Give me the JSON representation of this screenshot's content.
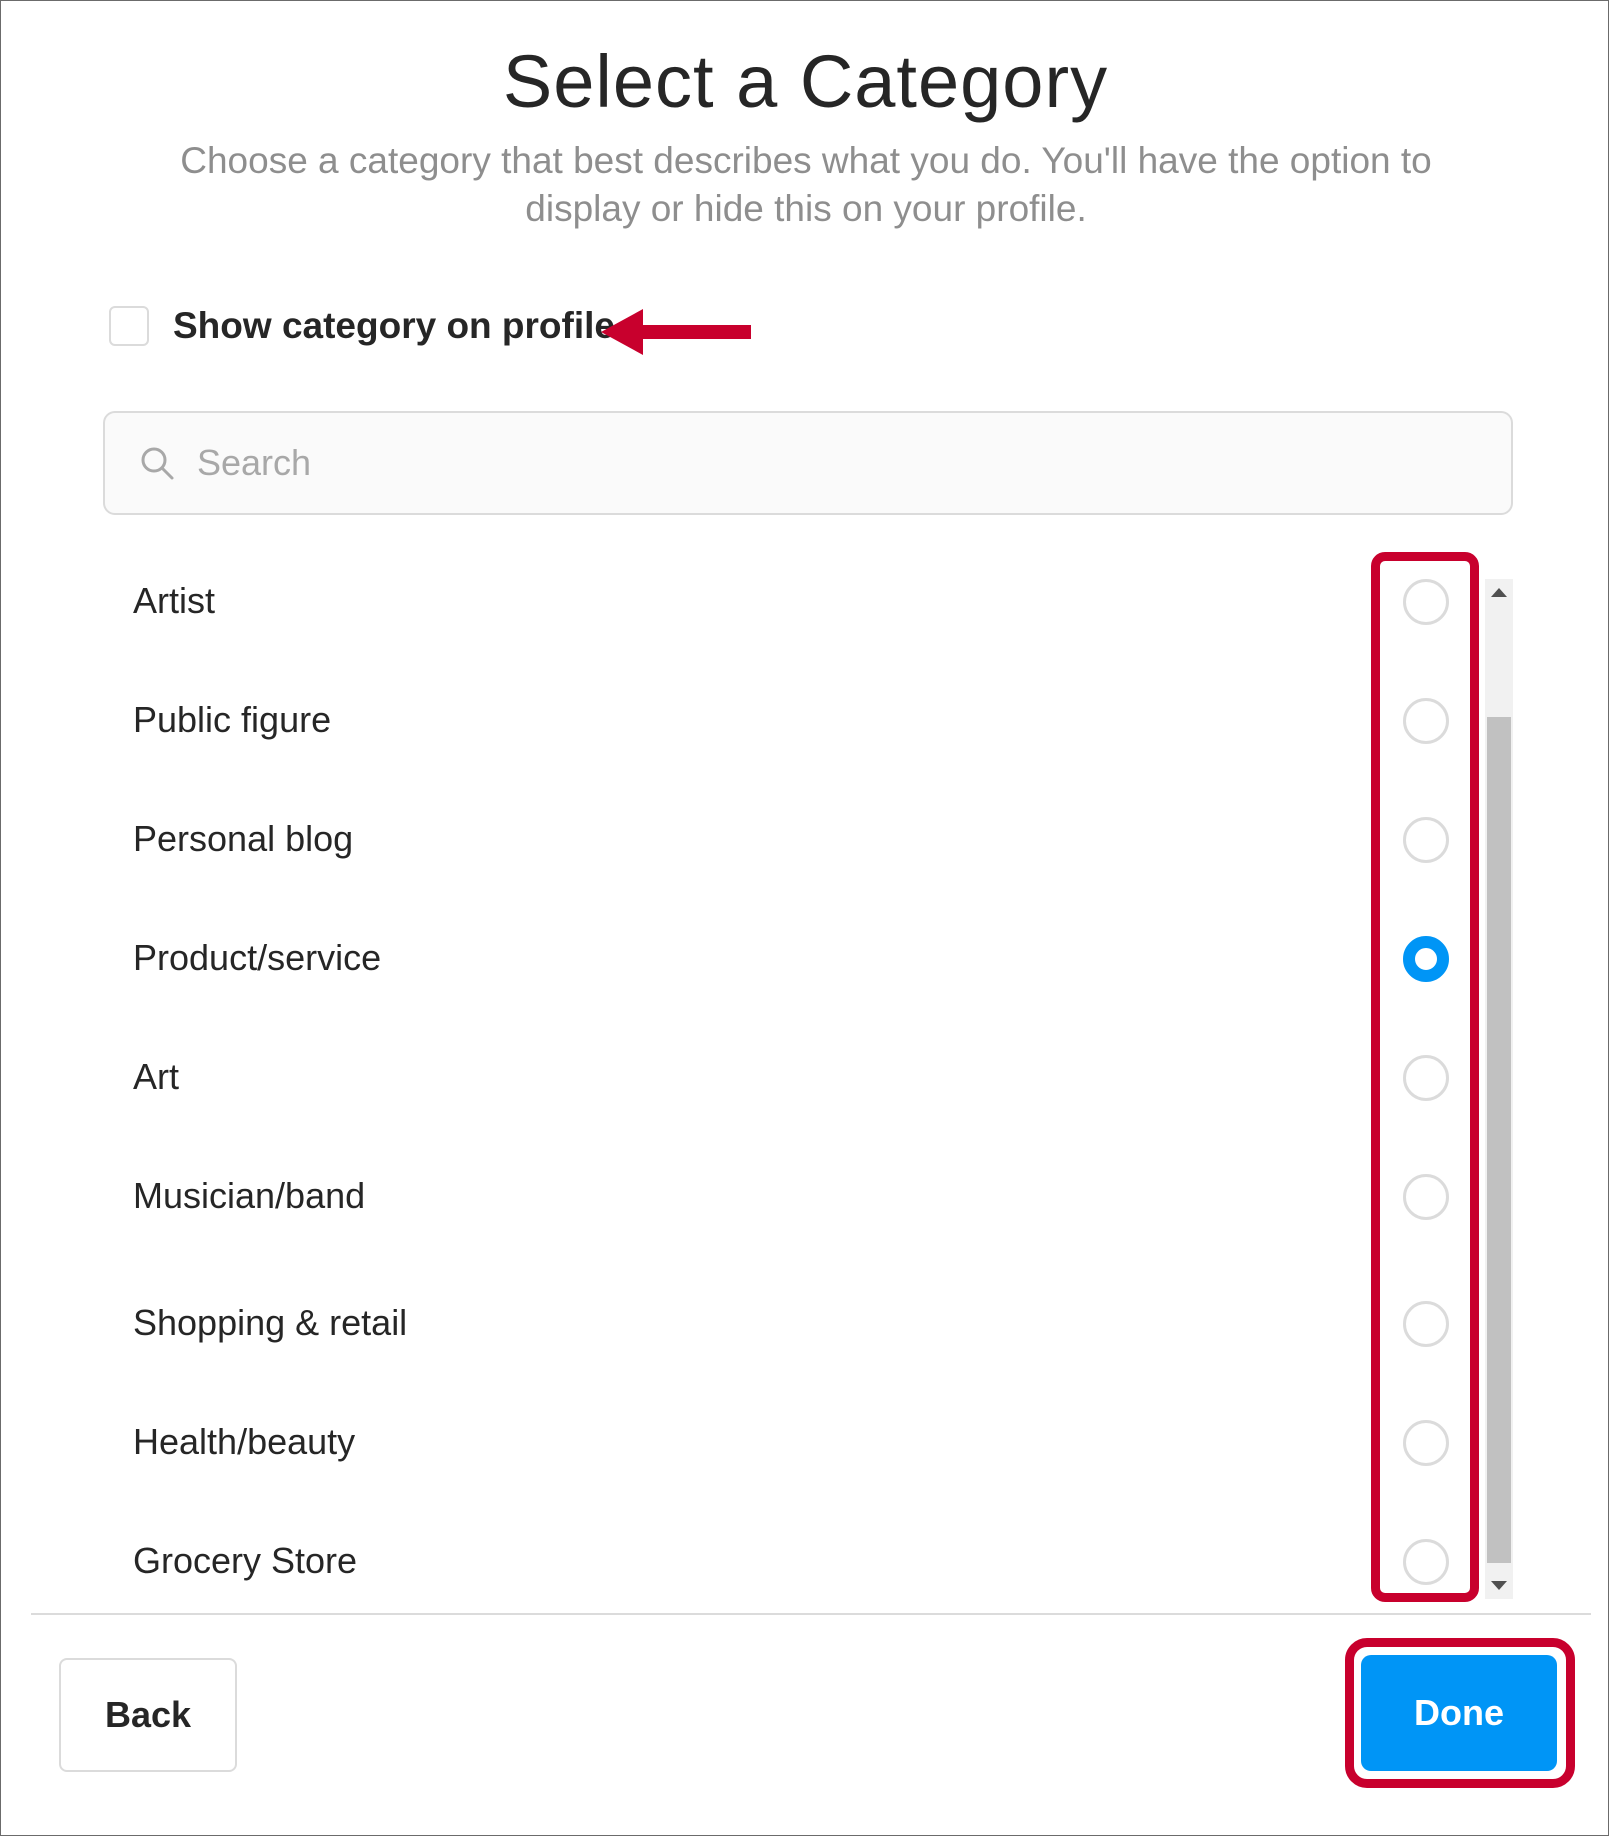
{
  "dialog": {
    "title": "Select a Category",
    "subtitle": "Choose a category that best describes what you do. You'll have the option to display or hide this on your profile."
  },
  "show_category": {
    "label": "Show category on profile",
    "checked": false
  },
  "search": {
    "placeholder": "Search",
    "value": ""
  },
  "categories": [
    {
      "label": "Artist",
      "selected": false
    },
    {
      "label": "Public figure",
      "selected": false
    },
    {
      "label": "Personal blog",
      "selected": false
    },
    {
      "label": "Product/service",
      "selected": true
    },
    {
      "label": "Art",
      "selected": false
    },
    {
      "label": "Musician/band",
      "selected": false
    },
    {
      "label": "Shopping & retail",
      "selected": false
    },
    {
      "label": "Health/beauty",
      "selected": false
    },
    {
      "label": "Grocery Store",
      "selected": false
    }
  ],
  "footer": {
    "back_label": "Back",
    "done_label": "Done"
  },
  "colors": {
    "accent": "#0095f6",
    "annotation": "#c8002d"
  },
  "icons": {
    "search": "search-icon",
    "arrow": "arrow-left-icon"
  }
}
